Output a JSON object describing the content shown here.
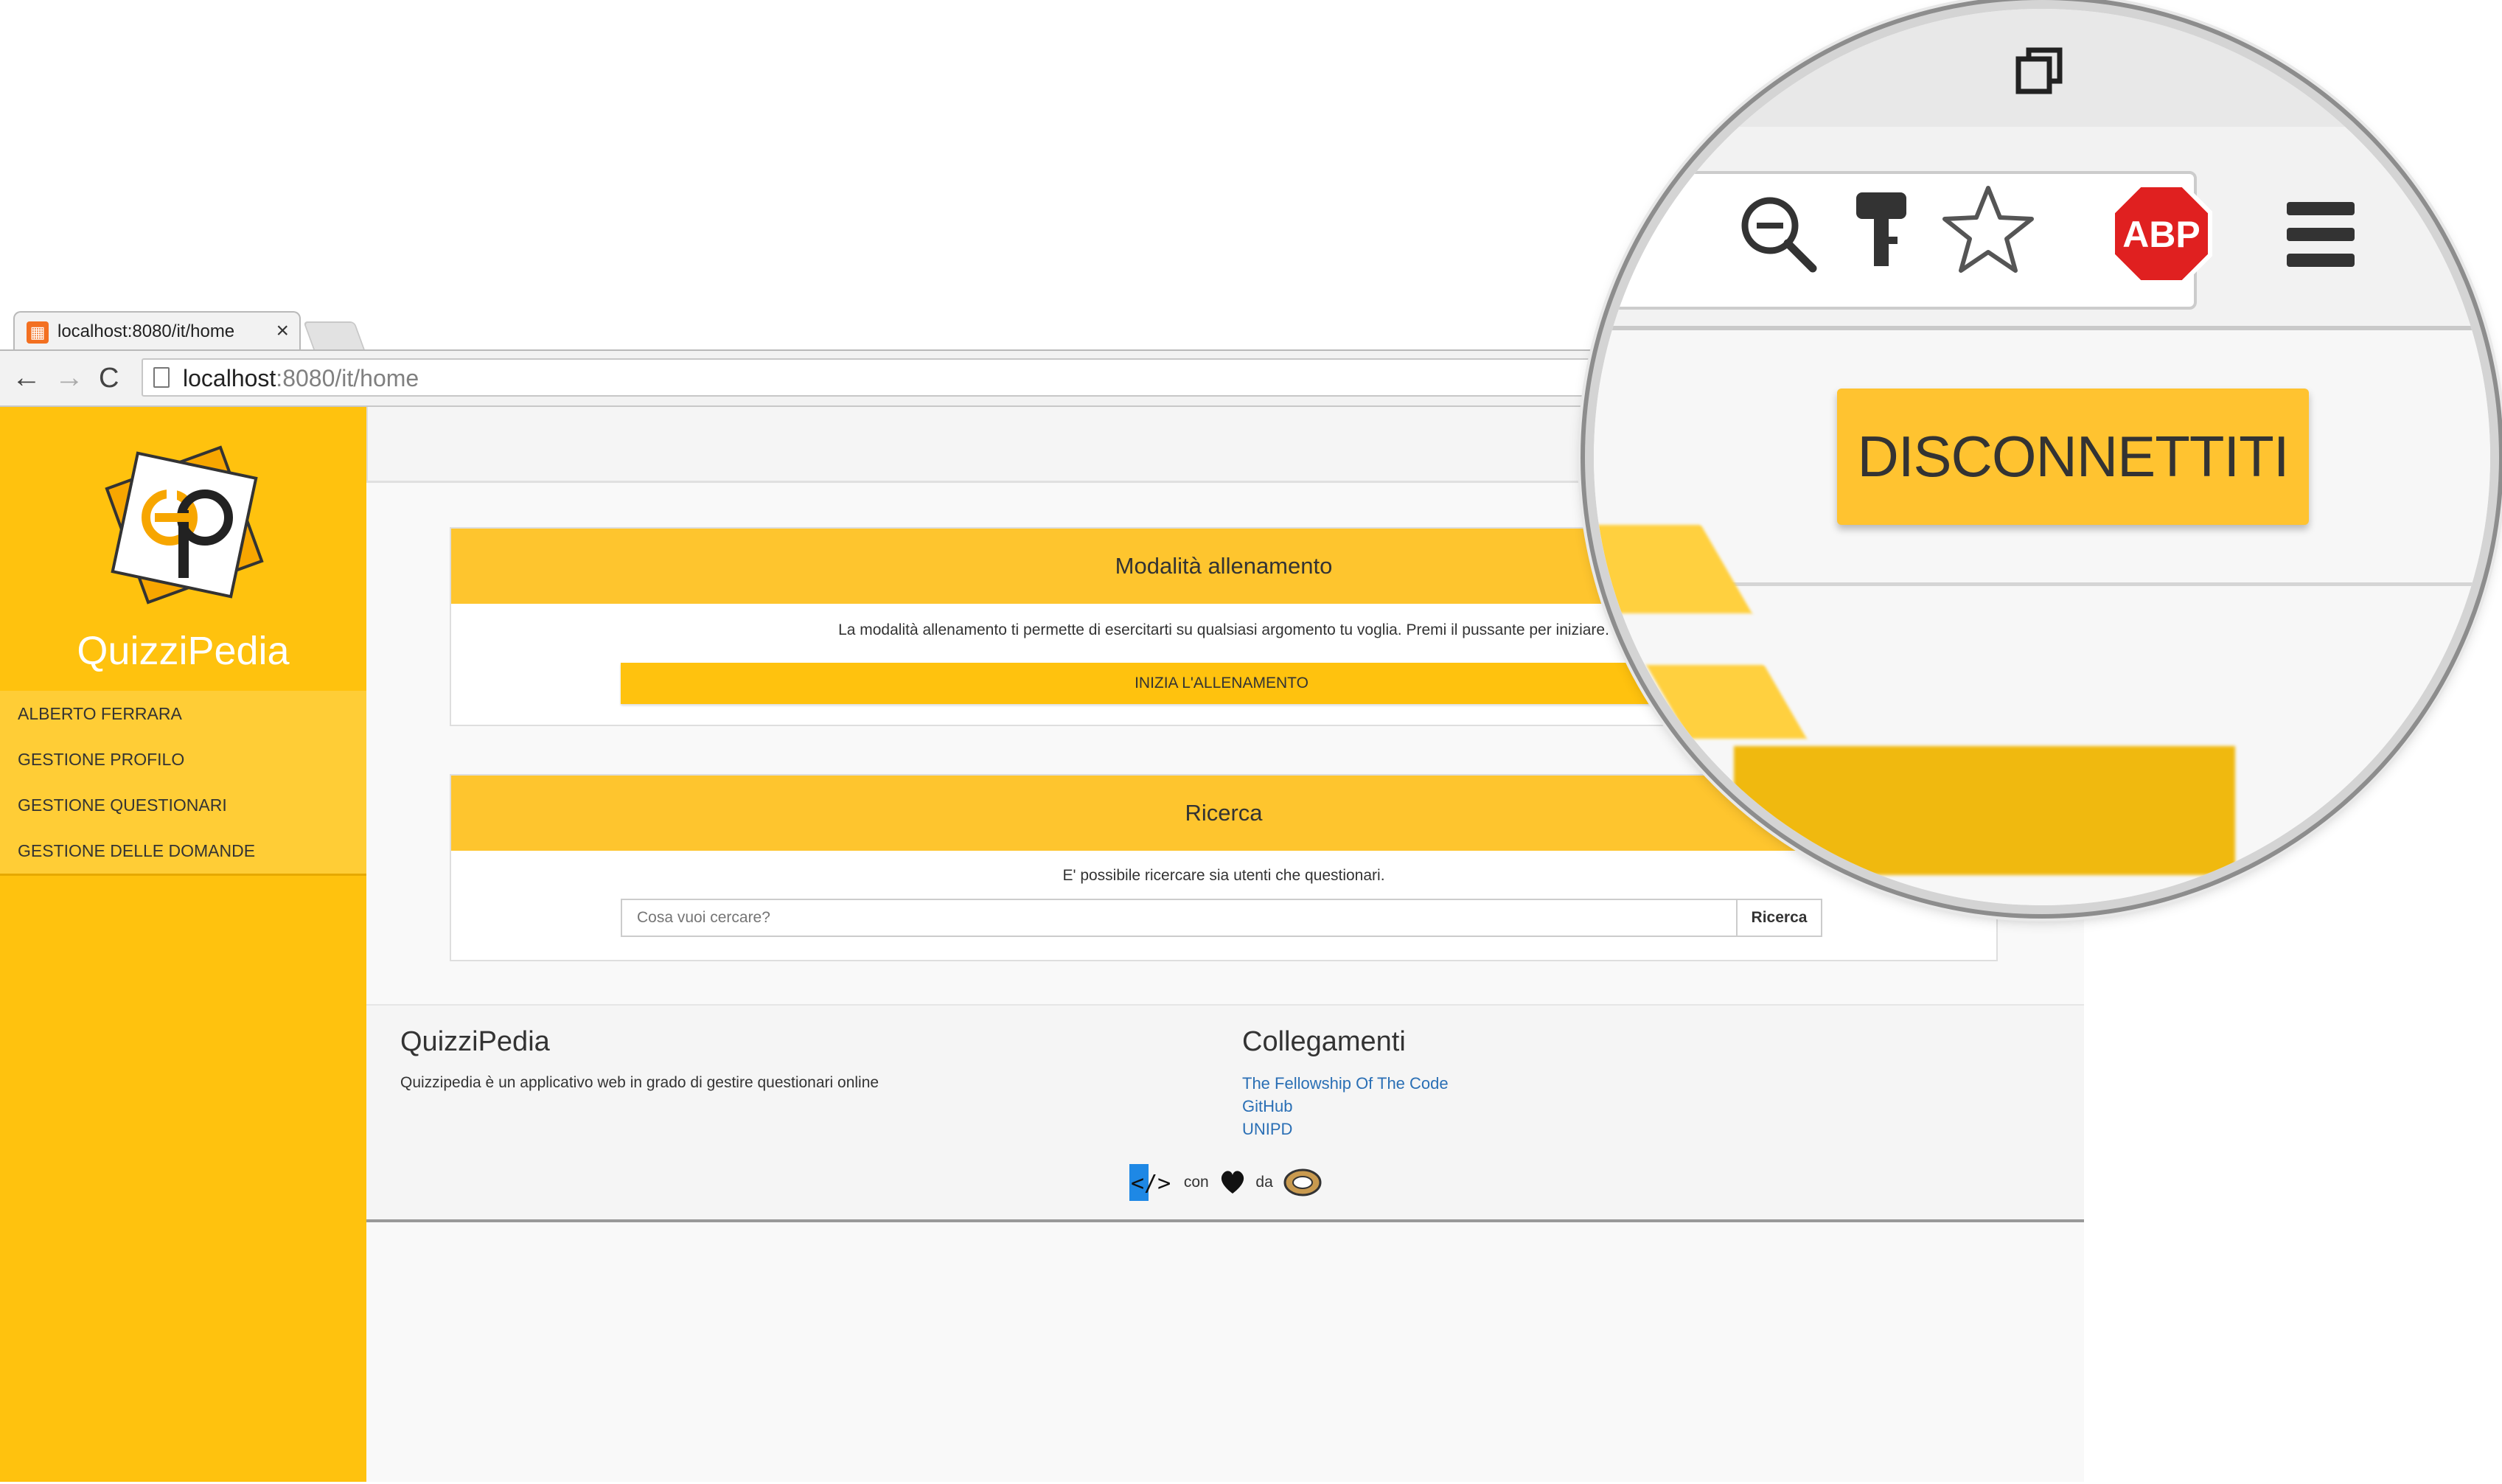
{
  "browser": {
    "tab_title": "localhost:8080/it/home",
    "close_glyph": "×",
    "url_host": "localhost",
    "url_path": ":8080/it/home"
  },
  "sidebar": {
    "brand": "QuizziPedia",
    "items": [
      {
        "label": "ALBERTO FERRARA"
      },
      {
        "label": "GESTIONE PROFILO"
      },
      {
        "label": "GESTIONE QUESTIONARI"
      },
      {
        "label": "GESTIONE DELLE DOMANDE"
      }
    ]
  },
  "training": {
    "title": "Modalità allenamento",
    "description": "La modalità allenamento ti permette di esercitarti su qualsiasi argomento tu voglia. Premi il pussante per iniziare.",
    "button": "INIZIA L'ALLENAMENTO"
  },
  "search": {
    "title": "Ricerca",
    "description": "E' possibile ricercare sia utenti che questionari.",
    "placeholder": "Cosa vuoi cercare?",
    "button": "Ricerca"
  },
  "footer": {
    "left_title": "QuizziPedia",
    "left_text": "Quizzipedia è un applicativo web in grado di gestire questionari online",
    "right_title": "Collegamenti",
    "links": [
      "The Fellowship Of The Code",
      "GitHub",
      "UNIPD"
    ],
    "credit_con": "con",
    "credit_da": "da"
  },
  "magnifier": {
    "logout_button": "DISCONNETTITI",
    "abp_label": "ABP"
  },
  "colors": {
    "brand_yellow": "#ffc20e",
    "panel_header": "#fec52e",
    "link_blue": "#2a6fb5"
  }
}
